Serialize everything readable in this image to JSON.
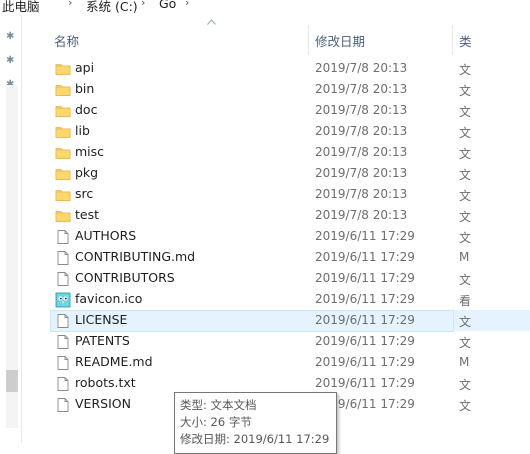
{
  "breadcrumb": [
    "此电脑",
    "系统 (C:)",
    "Go"
  ],
  "columns": {
    "name": "名称",
    "modified": "修改日期",
    "type": "类"
  },
  "nav_pins": [
    "pin-icon",
    "pin-icon",
    "pin-icon"
  ],
  "files": [
    {
      "name": "api",
      "date": "2019/7/8 20:13",
      "type": "文",
      "icon": "folder-icon"
    },
    {
      "name": "bin",
      "date": "2019/7/8 20:13",
      "type": "文",
      "icon": "folder-icon"
    },
    {
      "name": "doc",
      "date": "2019/7/8 20:13",
      "type": "文",
      "icon": "folder-icon"
    },
    {
      "name": "lib",
      "date": "2019/7/8 20:13",
      "type": "文",
      "icon": "folder-icon"
    },
    {
      "name": "misc",
      "date": "2019/7/8 20:13",
      "type": "文",
      "icon": "folder-icon"
    },
    {
      "name": "pkg",
      "date": "2019/7/8 20:13",
      "type": "文",
      "icon": "folder-icon"
    },
    {
      "name": "src",
      "date": "2019/7/8 20:13",
      "type": "文",
      "icon": "folder-icon"
    },
    {
      "name": "test",
      "date": "2019/7/8 20:13",
      "type": "文",
      "icon": "folder-icon"
    },
    {
      "name": "AUTHORS",
      "date": "2019/6/11 17:29",
      "type": "文",
      "icon": "file-icon"
    },
    {
      "name": "CONTRIBUTING.md",
      "date": "2019/6/11 17:29",
      "type": "M",
      "icon": "file-icon"
    },
    {
      "name": "CONTRIBUTORS",
      "date": "2019/6/11 17:29",
      "type": "文",
      "icon": "file-icon"
    },
    {
      "name": "favicon.ico",
      "date": "2019/6/11 17:29",
      "type": "看",
      "icon": "gopher-image-icon"
    },
    {
      "name": "LICENSE",
      "date": "2019/6/11 17:29",
      "type": "文",
      "icon": "file-icon",
      "selected": true
    },
    {
      "name": "PATENTS",
      "date": "2019/6/11 17:29",
      "type": "文",
      "icon": "file-icon"
    },
    {
      "name": "README.md",
      "date": "2019/6/11 17:29",
      "type": "M",
      "icon": "file-icon"
    },
    {
      "name": "robots.txt",
      "date": "2019/6/11 17:29",
      "type": "文",
      "icon": "file-icon"
    },
    {
      "name": "VERSION",
      "date": "2019/6/11 17:29",
      "type": "文",
      "icon": "file-icon"
    }
  ],
  "tooltip": {
    "type_line": "类型: 文本文档",
    "size_line": "大小: 26 字节",
    "modified_line": "修改日期: 2019/6/11 17:29"
  },
  "colors": {
    "header_text": "#4c607a",
    "selection_fill": "#e5f3ff",
    "selection_border": "#cce8ff",
    "folder": "#f8d775",
    "muted_text": "#6d6d6d"
  }
}
